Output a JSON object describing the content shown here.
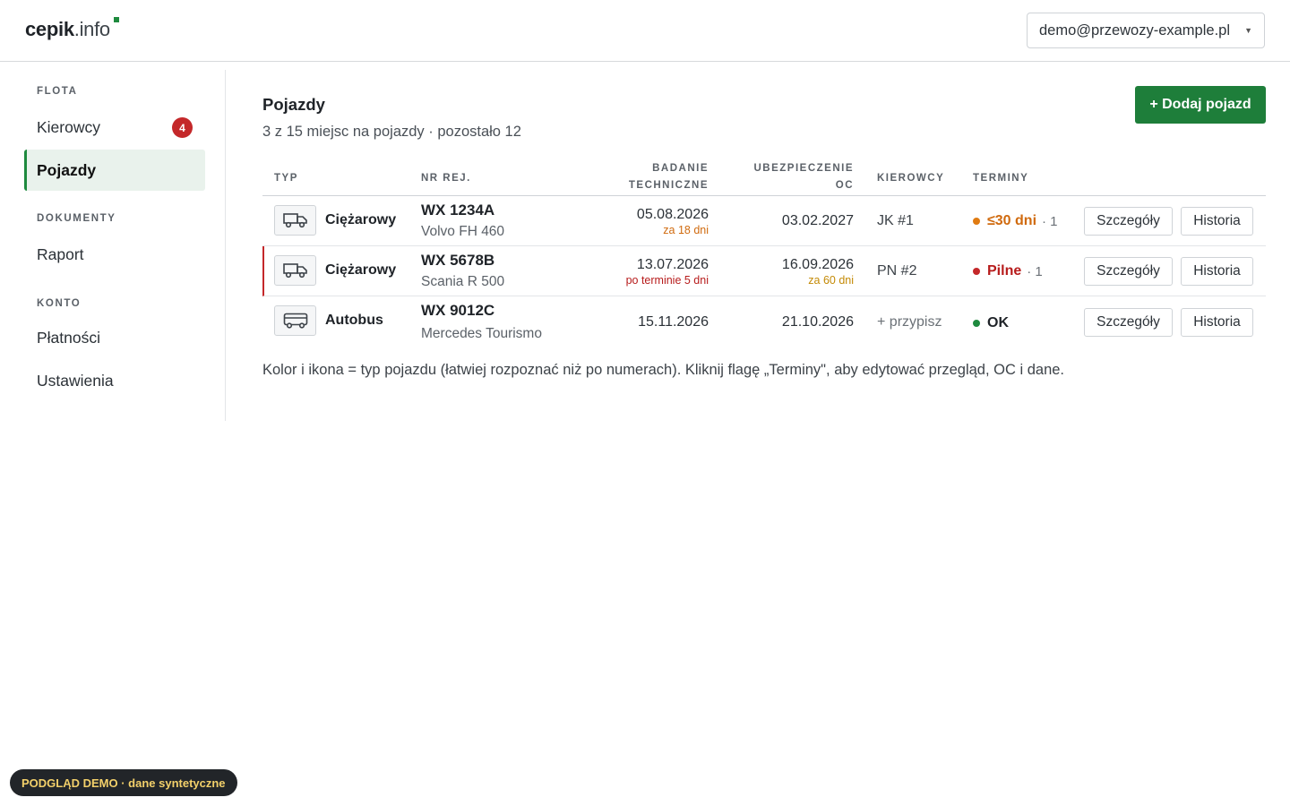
{
  "header": {
    "logo_brand": "cepik",
    "logo_tld": ".info",
    "account_email": "demo@przewozy-example.pl"
  },
  "sidebar": {
    "sections": [
      {
        "label": "FLOTA"
      },
      {
        "label": "DOKUMENTY"
      },
      {
        "label": "KONTO"
      }
    ],
    "items": [
      {
        "label": "Kierowcy",
        "badge": "4"
      },
      {
        "label": "Pojazdy"
      },
      {
        "label": "Raport"
      },
      {
        "label": "Płatności"
      },
      {
        "label": "Ustawienia"
      }
    ]
  },
  "main": {
    "title": "Pojazdy",
    "subtitle": "3 z 15 miejsc na pojazdy · pozostało 12",
    "add_button": "+ Dodaj pojazd"
  },
  "table": {
    "headers": {
      "type": "TYP",
      "plate": "NR REJ.",
      "inspection_1": "BADANIE",
      "inspection_2": "TECHNICZNE",
      "insurance_1": "UBEZPIECZENIE",
      "insurance_2": "OC",
      "drivers": "KIEROWCY",
      "terms": "TERMINY"
    },
    "rows": [
      {
        "type": "Ciężarowy",
        "icon": "truck-icon",
        "plate": "WX 1234A",
        "model": "Volvo FH 460",
        "inspection_date": "05.08.2026",
        "inspection_note": "za 18 dni",
        "insurance_date": "03.02.2027",
        "insurance_note": "",
        "driver": "JK #1",
        "term_status": "≤30 dni",
        "term_count": "· 1",
        "status_color": "#e07b12",
        "details": "Szczegóły",
        "history": "Historia"
      },
      {
        "type": "Ciężarowy",
        "icon": "truck-icon",
        "plate": "WX 5678B",
        "model": "Scania R 500",
        "inspection_date": "13.07.2026",
        "inspection_note": "po terminie 5 dni",
        "insurance_date": "16.09.2026",
        "insurance_note": "za 60 dni",
        "driver": "PN #2",
        "term_status": "Pilne",
        "term_count": "· 1",
        "status_color": "#c4282a",
        "details": "Szczegóły",
        "history": "Historia"
      },
      {
        "type": "Autobus",
        "icon": "bus-icon",
        "plate": "WX 9012C",
        "model": "Mercedes Tourismo",
        "inspection_date": "15.11.2026",
        "inspection_note": "",
        "insurance_date": "21.10.2026",
        "insurance_note": "",
        "driver": "+ przypisz",
        "term_status": "OK",
        "term_count": "",
        "status_color": "#1e8a3e",
        "details": "Szczegóły",
        "history": "Historia"
      }
    ]
  },
  "note": "Kolor i ikona = typ pojazdu (łatwiej rozpoznać niż po numerach). Kliknij flagę „Terminy\", aby edytować przegląd, OC i dane.",
  "demo_pill": "PODGLĄD DEMO · dane syntetyczne",
  "colors": {
    "accent": "#1e7e3a",
    "urgent": "#c4282a",
    "warning": "#e07b12",
    "amber": "#c48a06"
  }
}
